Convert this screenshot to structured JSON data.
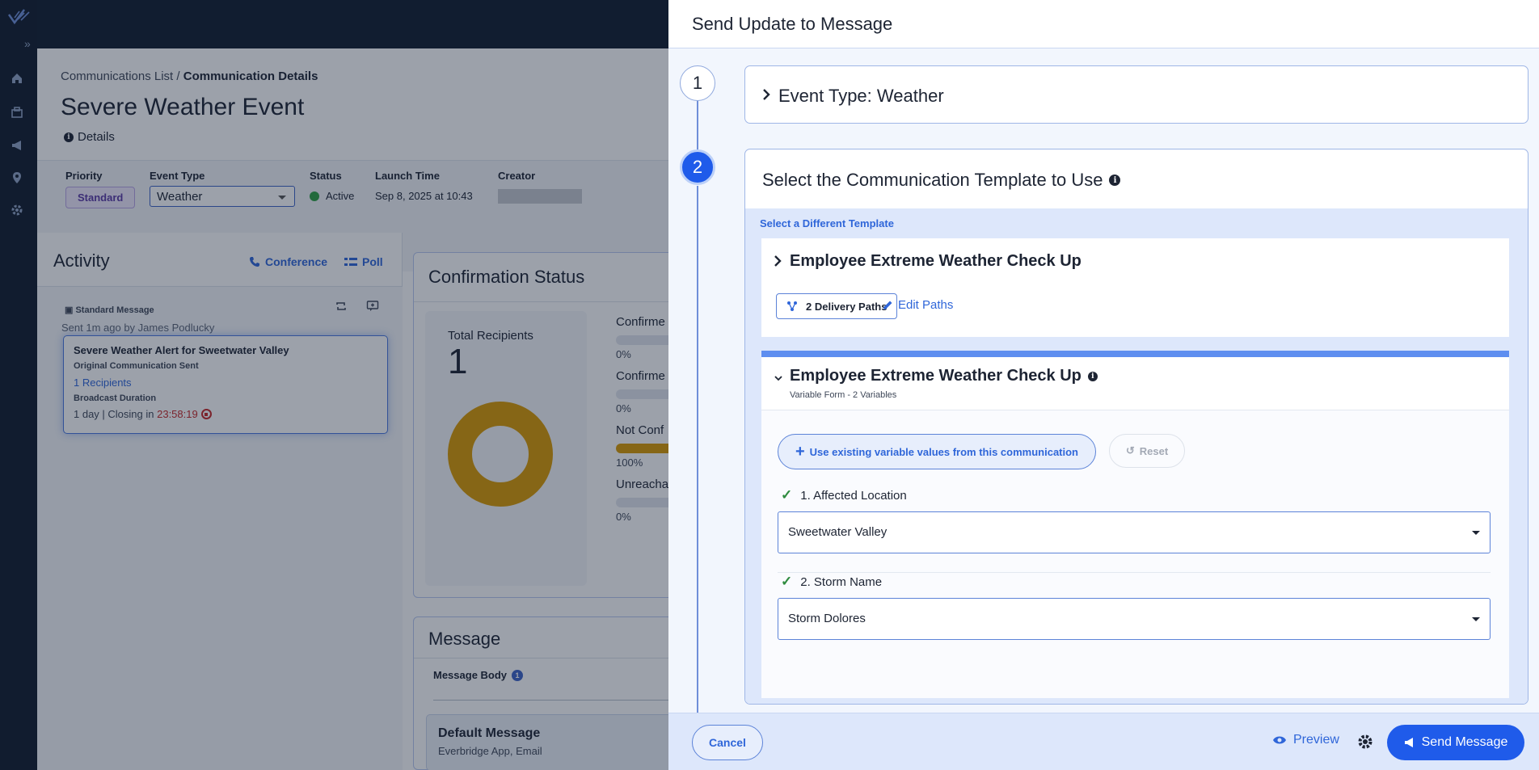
{
  "background_page": {
    "breadcrumb": {
      "parent": "Communications List",
      "separator": " / ",
      "current": "Communication Details"
    },
    "title": "Severe Weather Event",
    "details_label": "Details",
    "meta": {
      "priority_label": "Priority",
      "priority_value": "Standard",
      "event_type_label": "Event Type",
      "event_type_value": "Weather",
      "status_label": "Status",
      "status_value": "Active",
      "launch_time_label": "Launch Time",
      "launch_time_value": "Sep 8, 2025 at 10:43",
      "creator_label": "Creator"
    },
    "activity": {
      "title": "Activity",
      "conference_label": "Conference",
      "poll_label": "Poll",
      "message_type": "Standard Message",
      "sent_by": "Sent 1m ago by James Podlucky",
      "card": {
        "title": "Severe Weather Alert for Sweetwater Valley",
        "subtitle": "Original Communication Sent",
        "recipients": "1 Recipients",
        "duration_label": "Broadcast Duration",
        "duration_prefix": "1 day | Closing in ",
        "countdown": "23:58:19"
      }
    },
    "confirmation": {
      "title": "Confirmation Status",
      "total_label": "Total Recipients",
      "total_value": "1",
      "rows": [
        {
          "label": "Confirme",
          "pct": "0%",
          "fill": 0
        },
        {
          "label": "Confirme",
          "pct": "0%",
          "fill": 0
        },
        {
          "label": "Not Conf",
          "pct": "100%",
          "fill": 1
        },
        {
          "label": "Unreacha",
          "pct": "0%",
          "fill": 0
        }
      ]
    },
    "message": {
      "title": "Message",
      "body_label": "Message Body",
      "body_badge": "1",
      "default_title": "Default Message",
      "default_sub": "Everbridge App, Email"
    }
  },
  "drawer": {
    "title": "Send Update to Message",
    "steps": {
      "step1_number": "1",
      "step2_number": "2",
      "step1_label": "Event Type: Weather",
      "step2_label": "Select the Communication Template to Use"
    },
    "select_different": "Select a Different Template",
    "template_collapsed": {
      "name": "Employee Extreme Weather Check Up",
      "delivery_paths": "2 Delivery Paths",
      "edit_paths": "Edit Paths"
    },
    "template_expanded": {
      "name": "Employee Extreme Weather Check Up",
      "subtitle": "Variable Form - 2 Variables",
      "use_existing": "Use existing variable values from this communication",
      "reset": "Reset",
      "variables": [
        {
          "label": "1. Affected Location",
          "value": "Sweetwater Valley"
        },
        {
          "label": "2. Storm Name",
          "value": "Storm Dolores"
        }
      ]
    },
    "footer": {
      "cancel": "Cancel",
      "preview": "Preview",
      "send": "Send Message"
    }
  },
  "colors": {
    "primary": "#1f5bea",
    "link": "#2f66d9",
    "donut": "#d99a00",
    "countdown": "#c62828",
    "success": "#2e8b3e"
  }
}
